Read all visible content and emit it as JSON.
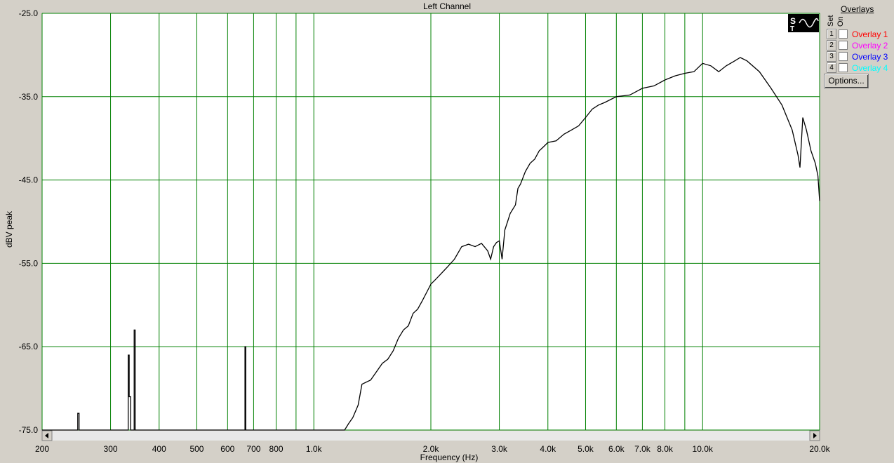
{
  "chart_data": {
    "type": "line",
    "title": "Left Channel",
    "xlabel": "Frequency (Hz)",
    "ylabel": "dBV peak",
    "xscale": "log",
    "xlim": [
      200,
      20000
    ],
    "ylim": [
      -75,
      -25
    ],
    "yticks": [
      -25,
      -35,
      -45,
      -55,
      -65,
      -75
    ],
    "ytick_labels": [
      "-25.0",
      "-35.0",
      "-45.0",
      "-55.0",
      "-65.0",
      "-75.0"
    ],
    "xticks": [
      200,
      300,
      400,
      500,
      600,
      700,
      800,
      1000,
      2000,
      3000,
      4000,
      5000,
      6000,
      7000,
      8000,
      10000,
      20000
    ],
    "xtick_labels": [
      "200",
      "300",
      "400",
      "500",
      "600",
      "700",
      "800",
      "1.0k",
      "2.0k",
      "3.0k",
      "4.0k",
      "5.0k",
      "6.0k",
      "7.0k",
      "8.0k",
      "10.0k",
      "20.0k"
    ],
    "grid": true,
    "series": [
      {
        "color": "#000000",
        "points": [
          [
            200,
            -75
          ],
          [
            247,
            -75
          ],
          [
            247,
            -73
          ],
          [
            249,
            -73
          ],
          [
            249,
            -75
          ],
          [
            333,
            -75
          ],
          [
            333,
            -66
          ],
          [
            335,
            -66
          ],
          [
            335,
            -71
          ],
          [
            338,
            -71
          ],
          [
            338,
            -75
          ],
          [
            345,
            -75
          ],
          [
            345,
            -63
          ],
          [
            347,
            -63
          ],
          [
            347,
            -75
          ],
          [
            665,
            -75
          ],
          [
            665,
            -65
          ],
          [
            668,
            -65
          ],
          [
            668,
            -75
          ],
          [
            1200,
            -75
          ],
          [
            1230,
            -74.2
          ],
          [
            1260,
            -73.5
          ],
          [
            1300,
            -72
          ],
          [
            1330,
            -69.5
          ],
          [
            1400,
            -69
          ],
          [
            1450,
            -68
          ],
          [
            1500,
            -67
          ],
          [
            1550,
            -66.5
          ],
          [
            1600,
            -65.5
          ],
          [
            1650,
            -64
          ],
          [
            1700,
            -63
          ],
          [
            1750,
            -62.5
          ],
          [
            1800,
            -61
          ],
          [
            1850,
            -60.5
          ],
          [
            1900,
            -59.5
          ],
          [
            1950,
            -58.5
          ],
          [
            2000,
            -57.5
          ],
          [
            2050,
            -57
          ],
          [
            2100,
            -56.5
          ],
          [
            2200,
            -55.5
          ],
          [
            2300,
            -54.5
          ],
          [
            2400,
            -53
          ],
          [
            2500,
            -52.7
          ],
          [
            2600,
            -53
          ],
          [
            2700,
            -52.6
          ],
          [
            2800,
            -53.5
          ],
          [
            2850,
            -54.5
          ],
          [
            2900,
            -53
          ],
          [
            2950,
            -52.5
          ],
          [
            3000,
            -52.3
          ],
          [
            3050,
            -54.5
          ],
          [
            3100,
            -51
          ],
          [
            3150,
            -50
          ],
          [
            3200,
            -49
          ],
          [
            3300,
            -48
          ],
          [
            3350,
            -46
          ],
          [
            3400,
            -45.5
          ],
          [
            3500,
            -44
          ],
          [
            3600,
            -43
          ],
          [
            3700,
            -42.5
          ],
          [
            3800,
            -41.5
          ],
          [
            3900,
            -41
          ],
          [
            4000,
            -40.5
          ],
          [
            4200,
            -40.3
          ],
          [
            4400,
            -39.5
          ],
          [
            4600,
            -39
          ],
          [
            4800,
            -38.5
          ],
          [
            5000,
            -37.5
          ],
          [
            5200,
            -36.5
          ],
          [
            5400,
            -36
          ],
          [
            5600,
            -35.7
          ],
          [
            6000,
            -35
          ],
          [
            6500,
            -34.8
          ],
          [
            7000,
            -34
          ],
          [
            7500,
            -33.7
          ],
          [
            8000,
            -33
          ],
          [
            8500,
            -32.5
          ],
          [
            9000,
            -32.2
          ],
          [
            9500,
            -32
          ],
          [
            10000,
            -31
          ],
          [
            10500,
            -31.3
          ],
          [
            11000,
            -32
          ],
          [
            11500,
            -31.3
          ],
          [
            12000,
            -30.8
          ],
          [
            12500,
            -30.3
          ],
          [
            13000,
            -30.7
          ],
          [
            14000,
            -32
          ],
          [
            15000,
            -34
          ],
          [
            16000,
            -36
          ],
          [
            17000,
            -39
          ],
          [
            17600,
            -42
          ],
          [
            17800,
            -43.5
          ],
          [
            18100,
            -37.5
          ],
          [
            18500,
            -39
          ],
          [
            19000,
            -41.5
          ],
          [
            19500,
            -43
          ],
          [
            19800,
            -44.5
          ],
          [
            20000,
            -47.5
          ]
        ]
      }
    ]
  },
  "overlays": {
    "title": "Overlays",
    "header_set": "Set",
    "header_on": "On",
    "items": [
      {
        "num": "1",
        "label": "Overlay 1",
        "color": "#ff0000"
      },
      {
        "num": "2",
        "label": "Overlay 2",
        "color": "#ff00ff"
      },
      {
        "num": "3",
        "label": "Overlay 3",
        "color": "#0000ff"
      },
      {
        "num": "4",
        "label": "Overlay 4",
        "color": "#00ffff"
      }
    ],
    "options_label": "Options..."
  },
  "colors": {
    "background": "#d4d0c8",
    "plot_bg": "#ffffff",
    "grid": "#008000",
    "trace": "#000000"
  }
}
